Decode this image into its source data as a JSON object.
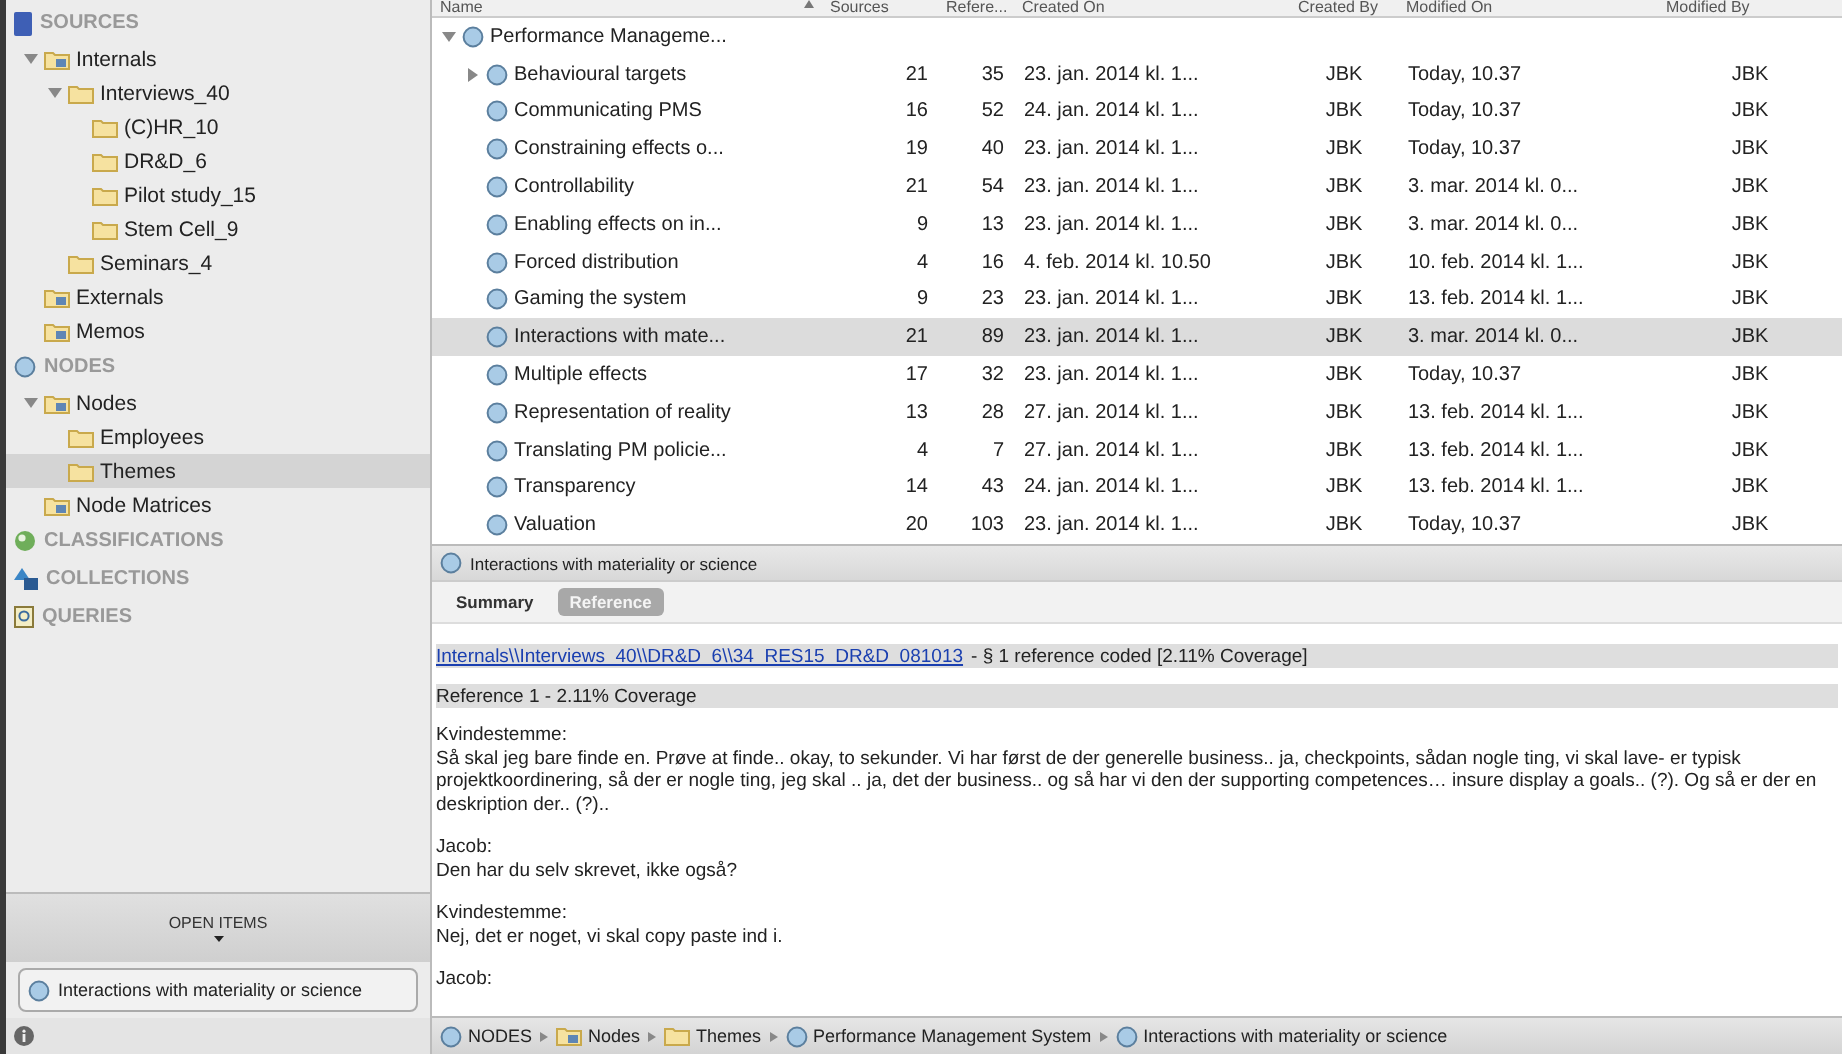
{
  "sidebar": {
    "sections": [
      {
        "title": "SOURCES",
        "kind": "sources",
        "children": [
          {
            "label": "Internals",
            "kind": "special-folder",
            "expanded": true,
            "selected": false,
            "children": [
              {
                "label": "Interviews_40",
                "kind": "folder",
                "expanded": true,
                "selected": false,
                "children": [
                  {
                    "label": "(C)HR_10",
                    "kind": "folder",
                    "selected": false
                  },
                  {
                    "label": "DR&D_6",
                    "kind": "folder",
                    "selected": false
                  },
                  {
                    "label": "Pilot study_15",
                    "kind": "folder",
                    "selected": false
                  },
                  {
                    "label": "Stem Cell_9",
                    "kind": "folder",
                    "selected": false
                  }
                ]
              },
              {
                "label": "Seminars_4",
                "kind": "folder",
                "selected": false
              }
            ]
          },
          {
            "label": "Externals",
            "kind": "special-folder",
            "selected": false
          },
          {
            "label": "Memos",
            "kind": "special-folder",
            "selected": false
          }
        ]
      },
      {
        "title": "NODES",
        "kind": "nodes",
        "children": [
          {
            "label": "Nodes",
            "kind": "special-folder",
            "expanded": true,
            "selected": false,
            "children": [
              {
                "label": "Employees",
                "kind": "folder",
                "selected": false
              },
              {
                "label": "Themes",
                "kind": "folder",
                "selected": true
              }
            ]
          },
          {
            "label": "Node Matrices",
            "kind": "special-folder",
            "selected": false
          }
        ]
      },
      {
        "title": "CLASSIFICATIONS",
        "kind": "classifications"
      },
      {
        "title": "COLLECTIONS",
        "kind": "collections"
      },
      {
        "title": "QUERIES",
        "kind": "queries"
      }
    ],
    "open_items_title": "OPEN ITEMS",
    "open_items": [
      "Interactions with materiality or science"
    ]
  },
  "table": {
    "columns": [
      "Name",
      "Sources",
      "Refere...",
      "Created On",
      "Created By",
      "Modified On",
      "Modified By"
    ],
    "rows": [
      {
        "name": "Performance Manageme...",
        "expanded": true,
        "selected": false,
        "cells": [],
        "children": [
          {
            "name": "Behavioural targets",
            "has_children": true,
            "selected": false,
            "cells": [
              "21",
              "35",
              "23. jan. 2014 kl. 1...",
              "JBK",
              "Today, 10.37",
              "JBK"
            ]
          },
          {
            "name": "Communicating PMS",
            "selected": false,
            "cells": [
              "16",
              "52",
              "24. jan. 2014 kl. 1...",
              "JBK",
              "Today, 10.37",
              "JBK"
            ]
          },
          {
            "name": "Constraining effects o...",
            "selected": false,
            "cells": [
              "19",
              "40",
              "23. jan. 2014 kl. 1...",
              "JBK",
              "Today, 10.37",
              "JBK"
            ]
          },
          {
            "name": "Controllability",
            "selected": false,
            "cells": [
              "21",
              "54",
              "23. jan. 2014 kl. 1...",
              "JBK",
              "3. mar. 2014 kl. 0...",
              "JBK"
            ]
          },
          {
            "name": "Enabling effects on in...",
            "selected": false,
            "cells": [
              "9",
              "13",
              "23. jan. 2014 kl. 1...",
              "JBK",
              "3. mar. 2014 kl. 0...",
              "JBK"
            ]
          },
          {
            "name": "Forced distribution",
            "selected": false,
            "cells": [
              "4",
              "16",
              "4. feb. 2014 kl. 10.50",
              "JBK",
              "10. feb. 2014 kl. 1...",
              "JBK"
            ]
          },
          {
            "name": "Gaming the system",
            "selected": false,
            "cells": [
              "9",
              "23",
              "23. jan. 2014 kl. 1...",
              "JBK",
              "13. feb. 2014 kl. 1...",
              "JBK"
            ]
          },
          {
            "name": "Interactions with mate...",
            "selected": true,
            "cells": [
              "21",
              "89",
              "23. jan. 2014 kl. 1...",
              "JBK",
              "3. mar. 2014 kl. 0...",
              "JBK"
            ]
          },
          {
            "name": "Multiple effects",
            "selected": false,
            "cells": [
              "17",
              "32",
              "23. jan. 2014 kl. 1...",
              "JBK",
              "Today, 10.37",
              "JBK"
            ]
          },
          {
            "name": "Representation of reality",
            "selected": false,
            "cells": [
              "13",
              "28",
              "27. jan. 2014 kl. 1...",
              "JBK",
              "13. feb. 2014 kl. 1...",
              "JBK"
            ]
          },
          {
            "name": "Translating PM policie...",
            "selected": false,
            "cells": [
              "4",
              "7",
              "27. jan. 2014 kl. 1...",
              "JBK",
              "13. feb. 2014 kl. 1...",
              "JBK"
            ]
          },
          {
            "name": "Transparency",
            "selected": false,
            "cells": [
              "14",
              "43",
              "24. jan. 2014 kl. 1...",
              "JBK",
              "13. feb. 2014 kl. 1...",
              "JBK"
            ]
          },
          {
            "name": "Valuation",
            "selected": false,
            "cells": [
              "20",
              "103",
              "23. jan. 2014 kl. 1...",
              "JBK",
              "Today, 10.37",
              "JBK"
            ]
          }
        ]
      }
    ]
  },
  "detail": {
    "title": "Interactions with materiality or science",
    "tabs": [
      {
        "label": "Summary",
        "selected": false
      },
      {
        "label": "Reference",
        "selected": true
      }
    ],
    "source_link": "Internals\\\\Interviews_40\\\\DR&D_6\\\\34_RES15_DR&D_081013",
    "source_info": "- § 1 reference coded [2.11% Coverage]",
    "reference": "Reference 1 - 2.11% Coverage",
    "paragraphs": [
      {
        "speaker": "Kvindestemme:",
        "text": "Så skal jeg bare finde en. Prøve at finde.. okay, to sekunder. Vi har først de der generelle business.. ja, checkpoints, sådan nogle ting, vi skal lave- er typisk projektkoordinering, så der er nogle ting, jeg skal .. ja, det der business.. og så har vi den der supporting competences… insure display a goals.. (?). Og så er der en deskription der.. (?).."
      },
      {
        "speaker": "Jacob:",
        "text": "Den har du selv skrevet, ikke også?"
      },
      {
        "speaker": "Kvindestemme:",
        "text": "Nej, det er noget, vi skal copy paste ind i."
      },
      {
        "speaker": "Jacob:"
      }
    ]
  },
  "breadcrumb": [
    {
      "label": "NODES",
      "kind": "node"
    },
    {
      "label": "Nodes",
      "kind": "special-folder"
    },
    {
      "label": "Themes",
      "kind": "folder"
    },
    {
      "label": "Performance Management System",
      "kind": "node"
    },
    {
      "label": "Interactions with materiality or science",
      "kind": "node"
    }
  ]
}
